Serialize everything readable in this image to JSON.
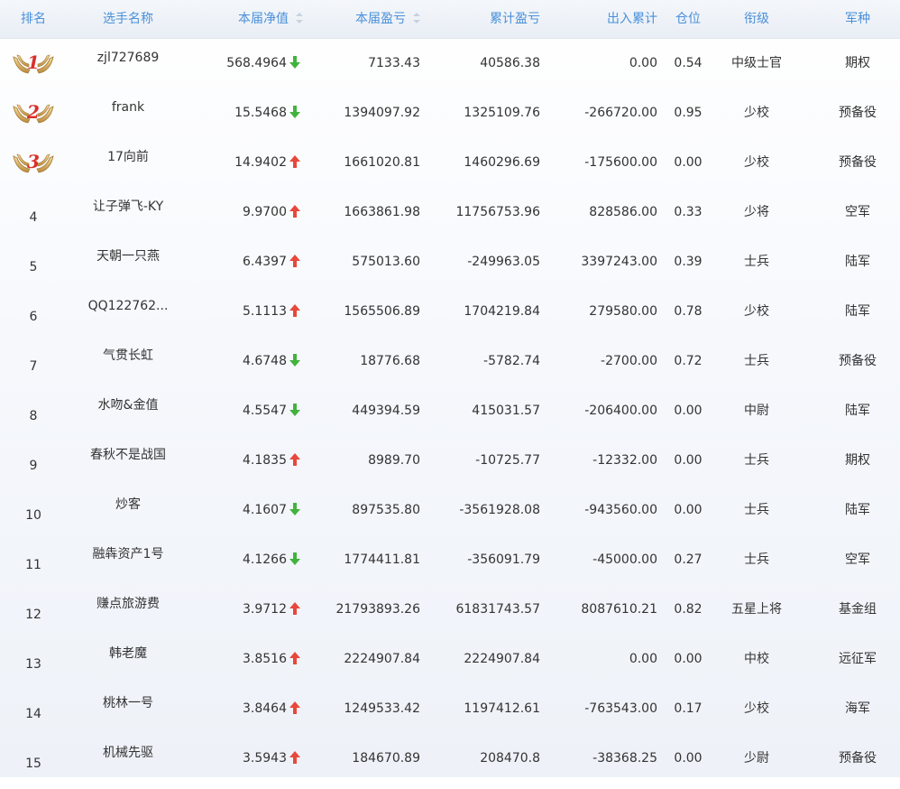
{
  "header": {
    "rank": "排名",
    "name": "选手名称",
    "nav": "本届净值",
    "pnl": "本届盈亏",
    "cum_pnl": "累计盈亏",
    "in_out": "出入累计",
    "position": "仓位",
    "title": "衔级",
    "corps": "军种"
  },
  "colors": {
    "header_text": "#4a90d9",
    "up": "#e8473b",
    "down": "#41b33d",
    "medal_number": "#d9302a"
  },
  "rows": [
    {
      "rank": "1",
      "medal": true,
      "name": "zjl727689",
      "nav": "568.4964",
      "trend": "down",
      "pnl": "7133.43",
      "cum_pnl": "40586.38",
      "in_out": "0.00",
      "position": "0.54",
      "title": "中级士官",
      "corps": "期权"
    },
    {
      "rank": "2",
      "medal": true,
      "name": "frank",
      "nav": "15.5468",
      "trend": "down",
      "pnl": "1394097.92",
      "cum_pnl": "1325109.76",
      "in_out": "-266720.00",
      "position": "0.95",
      "title": "少校",
      "corps": "预备役"
    },
    {
      "rank": "3",
      "medal": true,
      "name": "17向前",
      "nav": "14.9402",
      "trend": "up",
      "pnl": "1661020.81",
      "cum_pnl": "1460296.69",
      "in_out": "-175600.00",
      "position": "0.00",
      "title": "少校",
      "corps": "预备役"
    },
    {
      "rank": "4",
      "medal": false,
      "name": "让子弹飞-KY",
      "nav": "9.9700",
      "trend": "up",
      "pnl": "1663861.98",
      "cum_pnl": "11756753.96",
      "in_out": "828586.00",
      "position": "0.33",
      "title": "少将",
      "corps": "空军"
    },
    {
      "rank": "5",
      "medal": false,
      "name": "天朝一只燕",
      "nav": "6.4397",
      "trend": "up",
      "pnl": "575013.60",
      "cum_pnl": "-249963.05",
      "in_out": "3397243.00",
      "position": "0.39",
      "title": "士兵",
      "corps": "陆军"
    },
    {
      "rank": "6",
      "medal": false,
      "name": "QQ122762...",
      "nav": "5.1113",
      "trend": "up",
      "pnl": "1565506.89",
      "cum_pnl": "1704219.84",
      "in_out": "279580.00",
      "position": "0.78",
      "title": "少校",
      "corps": "陆军"
    },
    {
      "rank": "7",
      "medal": false,
      "name": "气贯长虹",
      "nav": "4.6748",
      "trend": "down",
      "pnl": "18776.68",
      "cum_pnl": "-5782.74",
      "in_out": "-2700.00",
      "position": "0.72",
      "title": "士兵",
      "corps": "预备役"
    },
    {
      "rank": "8",
      "medal": false,
      "name": "水吻&金值",
      "nav": "4.5547",
      "trend": "down",
      "pnl": "449394.59",
      "cum_pnl": "415031.57",
      "in_out": "-206400.00",
      "position": "0.00",
      "title": "中尉",
      "corps": "陆军"
    },
    {
      "rank": "9",
      "medal": false,
      "name": "春秋不是战国",
      "nav": "4.1835",
      "trend": "up",
      "pnl": "8989.70",
      "cum_pnl": "-10725.77",
      "in_out": "-12332.00",
      "position": "0.00",
      "title": "士兵",
      "corps": "期权"
    },
    {
      "rank": "10",
      "medal": false,
      "name": "炒客",
      "nav": "4.1607",
      "trend": "down",
      "pnl": "897535.80",
      "cum_pnl": "-3561928.08",
      "in_out": "-943560.00",
      "position": "0.00",
      "title": "士兵",
      "corps": "陆军"
    },
    {
      "rank": "11",
      "medal": false,
      "name": "融犇资产1号",
      "nav": "4.1266",
      "trend": "down",
      "pnl": "1774411.81",
      "cum_pnl": "-356091.79",
      "in_out": "-45000.00",
      "position": "0.27",
      "title": "士兵",
      "corps": "空军"
    },
    {
      "rank": "12",
      "medal": false,
      "name": "赚点旅游费",
      "nav": "3.9712",
      "trend": "up",
      "pnl": "21793893.26",
      "cum_pnl": "61831743.57",
      "in_out": "8087610.21",
      "position": "0.82",
      "title": "五星上将",
      "corps": "基金组"
    },
    {
      "rank": "13",
      "medal": false,
      "name": "韩老魔",
      "nav": "3.8516",
      "trend": "up",
      "pnl": "2224907.84",
      "cum_pnl": "2224907.84",
      "in_out": "0.00",
      "position": "0.00",
      "title": "中校",
      "corps": "远征军"
    },
    {
      "rank": "14",
      "medal": false,
      "name": "桃林一号",
      "nav": "3.8464",
      "trend": "up",
      "pnl": "1249533.42",
      "cum_pnl": "1197412.61",
      "in_out": "-763543.00",
      "position": "0.17",
      "title": "少校",
      "corps": "海军"
    },
    {
      "rank": "15",
      "medal": false,
      "name": "机械先驱",
      "nav": "3.5943",
      "trend": "up",
      "pnl": "184670.89",
      "cum_pnl": "208470.8",
      "in_out": "-38368.25",
      "position": "0.00",
      "title": "少尉",
      "corps": "预备役"
    }
  ]
}
